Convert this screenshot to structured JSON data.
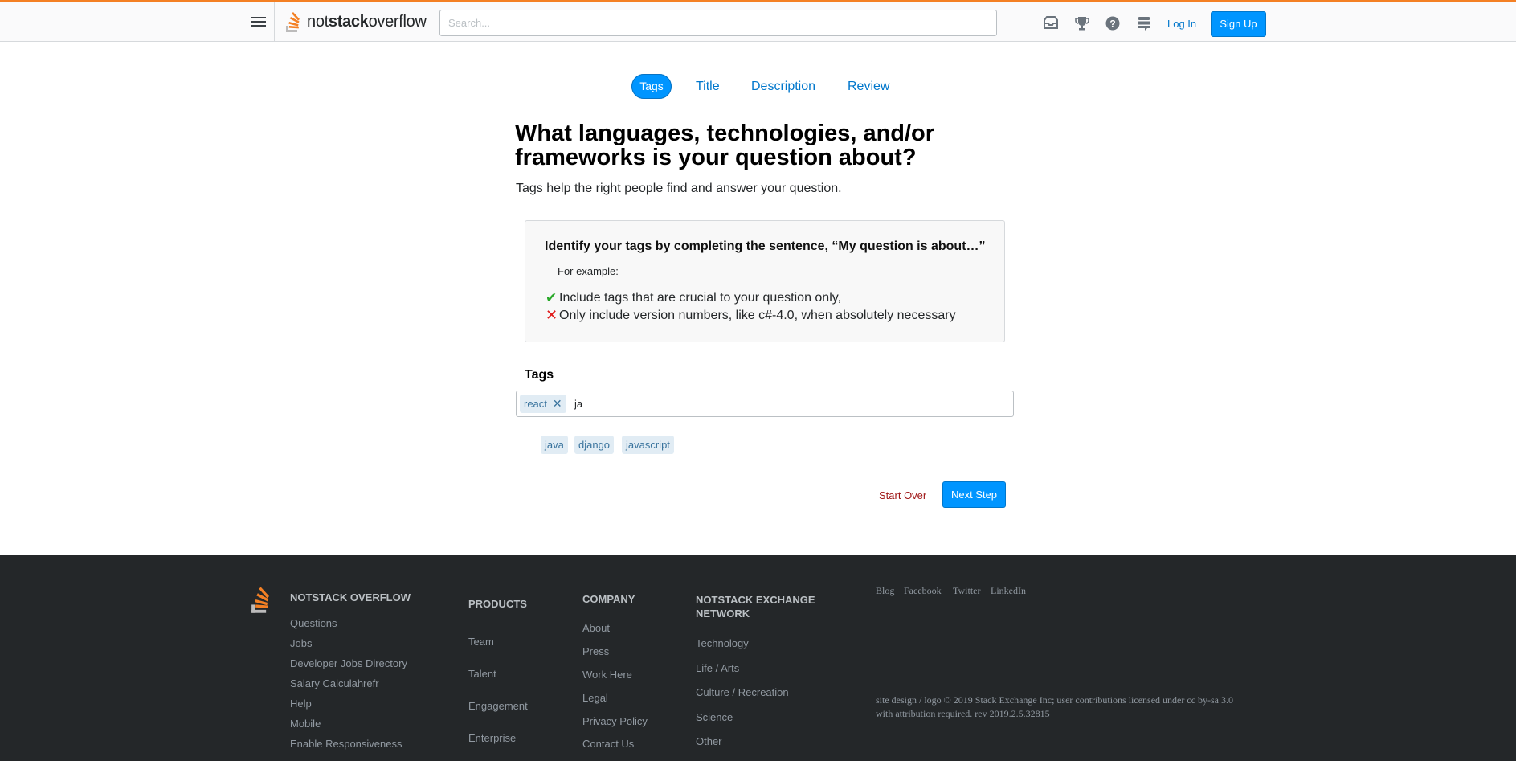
{
  "topbar": {
    "logo_prefix": "not",
    "logo_bold": "stack",
    "logo_suffix": "overflow",
    "search_placeholder": "Search...",
    "icons": [
      "inbox-icon",
      "trophy-icon",
      "help-icon",
      "stack-exchange-icon"
    ],
    "login_label": "Log In",
    "signup_label": "Sign Up"
  },
  "steps": [
    {
      "label": "Tags",
      "active": true
    },
    {
      "label": "Title",
      "active": false
    },
    {
      "label": "Description",
      "active": false
    },
    {
      "label": "Review",
      "active": false
    }
  ],
  "main": {
    "heading": "What languages, technologies, and/or frameworks is your question about?",
    "subheading": "Tags help the right people find and answer your question."
  },
  "infobox": {
    "title": "Identify your tags by completing the sentence, “My question is about…”",
    "example_label": "For example:",
    "rules": [
      {
        "kind": "do",
        "text": "Include tags that are crucial to your question only,"
      },
      {
        "kind": "dont",
        "text": "Only include version numbers, like c#-4.0, when absolutely necessary"
      }
    ]
  },
  "tags": {
    "label": "Tags",
    "selected": [
      {
        "name": "react",
        "remove_icon": "close-icon"
      }
    ],
    "input_value": "ja",
    "suggestions": [
      "java",
      "django",
      "javascript"
    ]
  },
  "actions": {
    "start_over": "Start Over",
    "next_step": "Next Step"
  },
  "footer": {
    "brand": {
      "title": "NOTSTACK OVERFLOW",
      "links": [
        "Questions",
        "Jobs",
        "Developer Jobs Directory",
        "Salary Calculahrefr",
        "Help",
        "Mobile",
        "Enable Responsiveness"
      ]
    },
    "products": {
      "title": "PRODUCTS",
      "links": [
        "Team",
        "Talent",
        "Engagement",
        "Enterprise"
      ]
    },
    "company": {
      "title": "COMPANY",
      "links": [
        "About",
        "Press",
        "Work Here",
        "Legal",
        "Privacy Policy",
        "Contact Us"
      ]
    },
    "network": {
      "title_line1": "NOTSTACK EXCHANGE",
      "title_line2": "NETWORK",
      "links": [
        "Technology",
        "Life / Arts",
        "Culture / Recreation",
        "Science",
        "Other"
      ]
    },
    "social": [
      "Blog",
      "Facebook",
      "Twitter",
      "LinkedIn"
    ],
    "copyright_line1": "site design / logo © 2019 Stack Exchange Inc; user contributions licensed under cc by-sa 3.0",
    "copyright_line2": "with attribution required. rev 2019.2.5.32815"
  },
  "colors": {
    "accent_orange": "#f48024",
    "primary_blue": "#0095ff",
    "link_blue": "#0077cc",
    "tag_bg": "#e1ecf4",
    "tag_text": "#39739d",
    "footer_bg": "#242729",
    "danger_red": "#9f1616"
  }
}
